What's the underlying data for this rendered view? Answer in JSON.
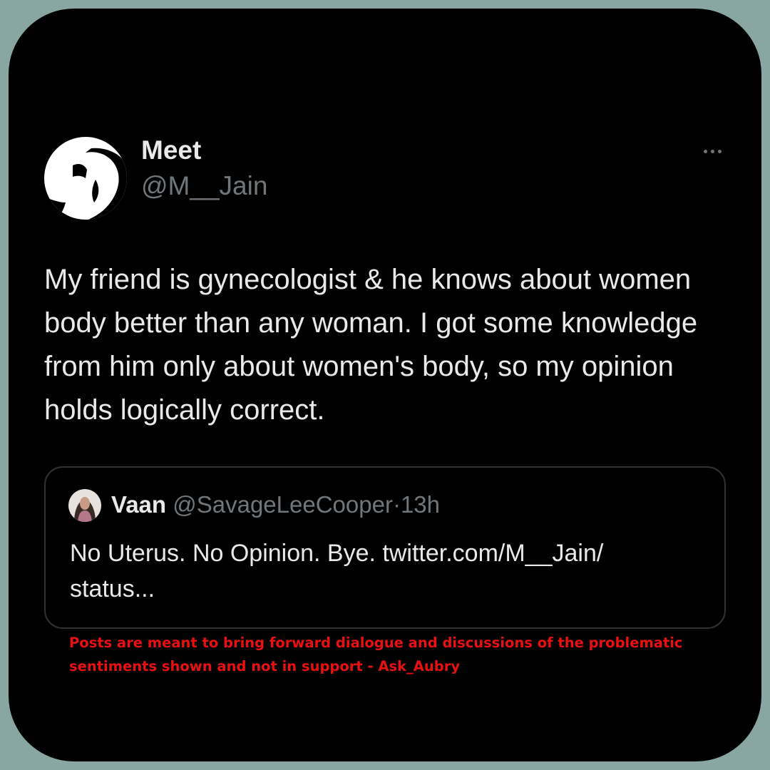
{
  "tweet": {
    "author": {
      "display_name": "Meet",
      "handle": "@M__Jain",
      "avatar_icon": "profile-silhouette-icon"
    },
    "more_icon": "more-options-icon",
    "text": "My friend is gynecologist & he knows about women body better than any woman. I got some knowledge from him only about women's body, so my opinion holds logically correct."
  },
  "quoted_tweet": {
    "display_name": "Vaan",
    "handle": "@SavageLeeCooper",
    "separator": "·",
    "time": "13h",
    "text": "No Uterus. No Opinion. Bye. twitter.com/M__Jain/\nstatus..."
  },
  "disclaimer": "Posts are meant to bring forward dialogue and discussions of the problematic sentiments shown and not in support - Ask_Aubry",
  "colors": {
    "page_background": "#8aa6a3",
    "card_background": "#000000",
    "primary_text": "#e7e9ea",
    "secondary_text": "#71767b",
    "border": "#2f3336",
    "disclaimer": "#e81010"
  }
}
